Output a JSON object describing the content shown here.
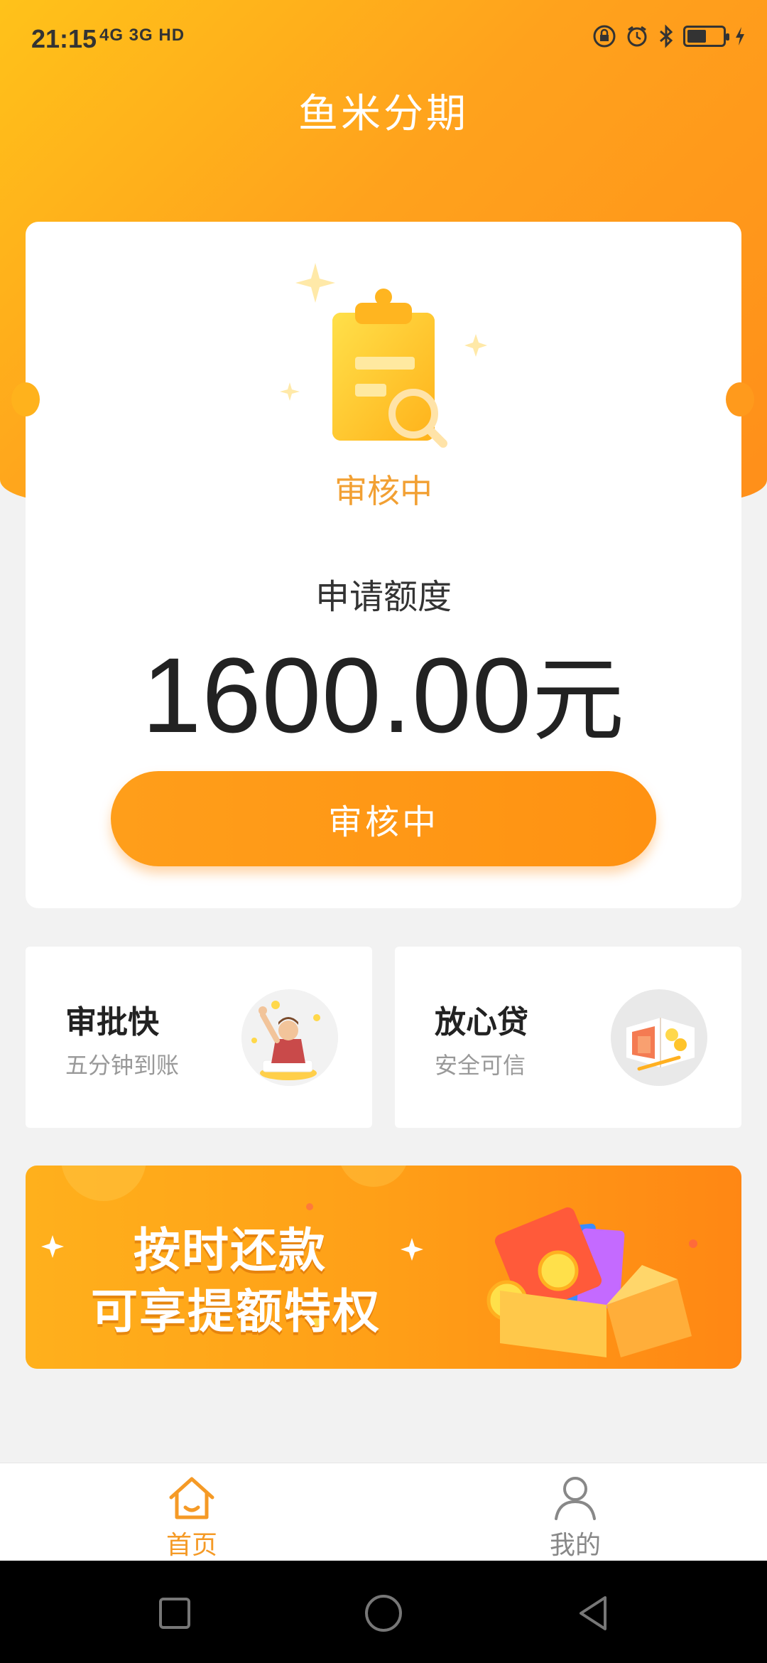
{
  "status_bar": {
    "time": "21:15",
    "network": "4G 3G HD"
  },
  "header": {
    "title": "鱼米分期"
  },
  "review_card": {
    "status_text": "审核中",
    "apply_label": "申请额度",
    "amount": "1600.00",
    "amount_unit": "元",
    "button_label": "审核中"
  },
  "features": [
    {
      "title": "审批快",
      "subtitle": "五分钟到账"
    },
    {
      "title": "放心贷",
      "subtitle": "安全可信"
    }
  ],
  "banner": {
    "line1": "按时还款",
    "line2": "可享提额特权"
  },
  "bottom_nav": {
    "items": [
      {
        "label": "首页",
        "active": true
      },
      {
        "label": "我的",
        "active": false
      }
    ]
  },
  "colors": {
    "accent": "#ff9a1a",
    "status_orange": "#f2a033",
    "background": "#f2f2f2"
  },
  "icons": [
    "lock-icon",
    "alarm-icon",
    "bluetooth-icon",
    "battery-icon",
    "clipboard-search-icon",
    "home-icon",
    "user-icon",
    "recent-apps-icon",
    "home-circle-icon",
    "back-icon"
  ]
}
